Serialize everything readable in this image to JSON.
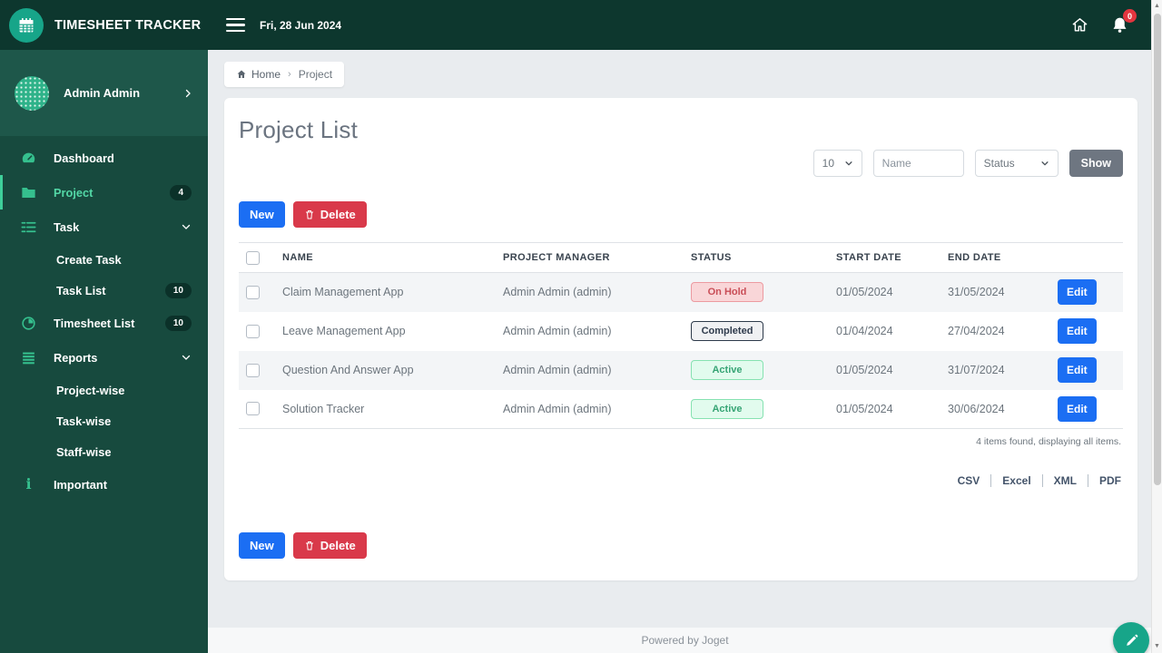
{
  "app": {
    "title": "TIMESHEET TRACKER",
    "date": "Fri, 28 Jun 2024",
    "notification_count": "0"
  },
  "sidebar": {
    "user": "Admin Admin",
    "items": [
      {
        "label": "Dashboard"
      },
      {
        "label": "Project",
        "badge": "4"
      },
      {
        "label": "Task"
      },
      {
        "label": "Create Task"
      },
      {
        "label": "Task List",
        "badge": "10"
      },
      {
        "label": "Timesheet List",
        "badge": "10"
      },
      {
        "label": "Reports"
      },
      {
        "label": "Project-wise"
      },
      {
        "label": "Task-wise"
      },
      {
        "label": "Staff-wise"
      },
      {
        "label": "Important"
      }
    ]
  },
  "breadcrumb": {
    "home": "Home",
    "separator": "›",
    "current": "Project"
  },
  "main": {
    "title": "Project List",
    "filters": {
      "page_size_value": "10",
      "name_placeholder": "Name",
      "status_placeholder": "Status",
      "show_label": "Show"
    },
    "actions": {
      "new_label": "New",
      "delete_label": "Delete"
    },
    "table": {
      "headers": [
        "NAME",
        "PROJECT MANAGER",
        "STATUS",
        "START DATE",
        "END DATE"
      ],
      "edit_label": "Edit",
      "rows": [
        {
          "name": "Claim Management App",
          "manager": "Admin Admin (admin)",
          "status": "On Hold",
          "start": "01/05/2024",
          "end": "31/05/2024"
        },
        {
          "name": "Leave Management App",
          "manager": "Admin Admin (admin)",
          "status": "Completed",
          "start": "01/04/2024",
          "end": "27/04/2024"
        },
        {
          "name": "Question And Answer App",
          "manager": "Admin Admin (admin)",
          "status": "Active",
          "start": "01/05/2024",
          "end": "31/07/2024"
        },
        {
          "name": "Solution Tracker",
          "manager": "Admin Admin (admin)",
          "status": "Active",
          "start": "01/05/2024",
          "end": "30/06/2024"
        }
      ],
      "summary": "4 items found, displaying all items.",
      "export_links": [
        "CSV",
        "Excel",
        "XML",
        "PDF"
      ]
    }
  },
  "footer": {
    "text": "Powered by Joget"
  }
}
